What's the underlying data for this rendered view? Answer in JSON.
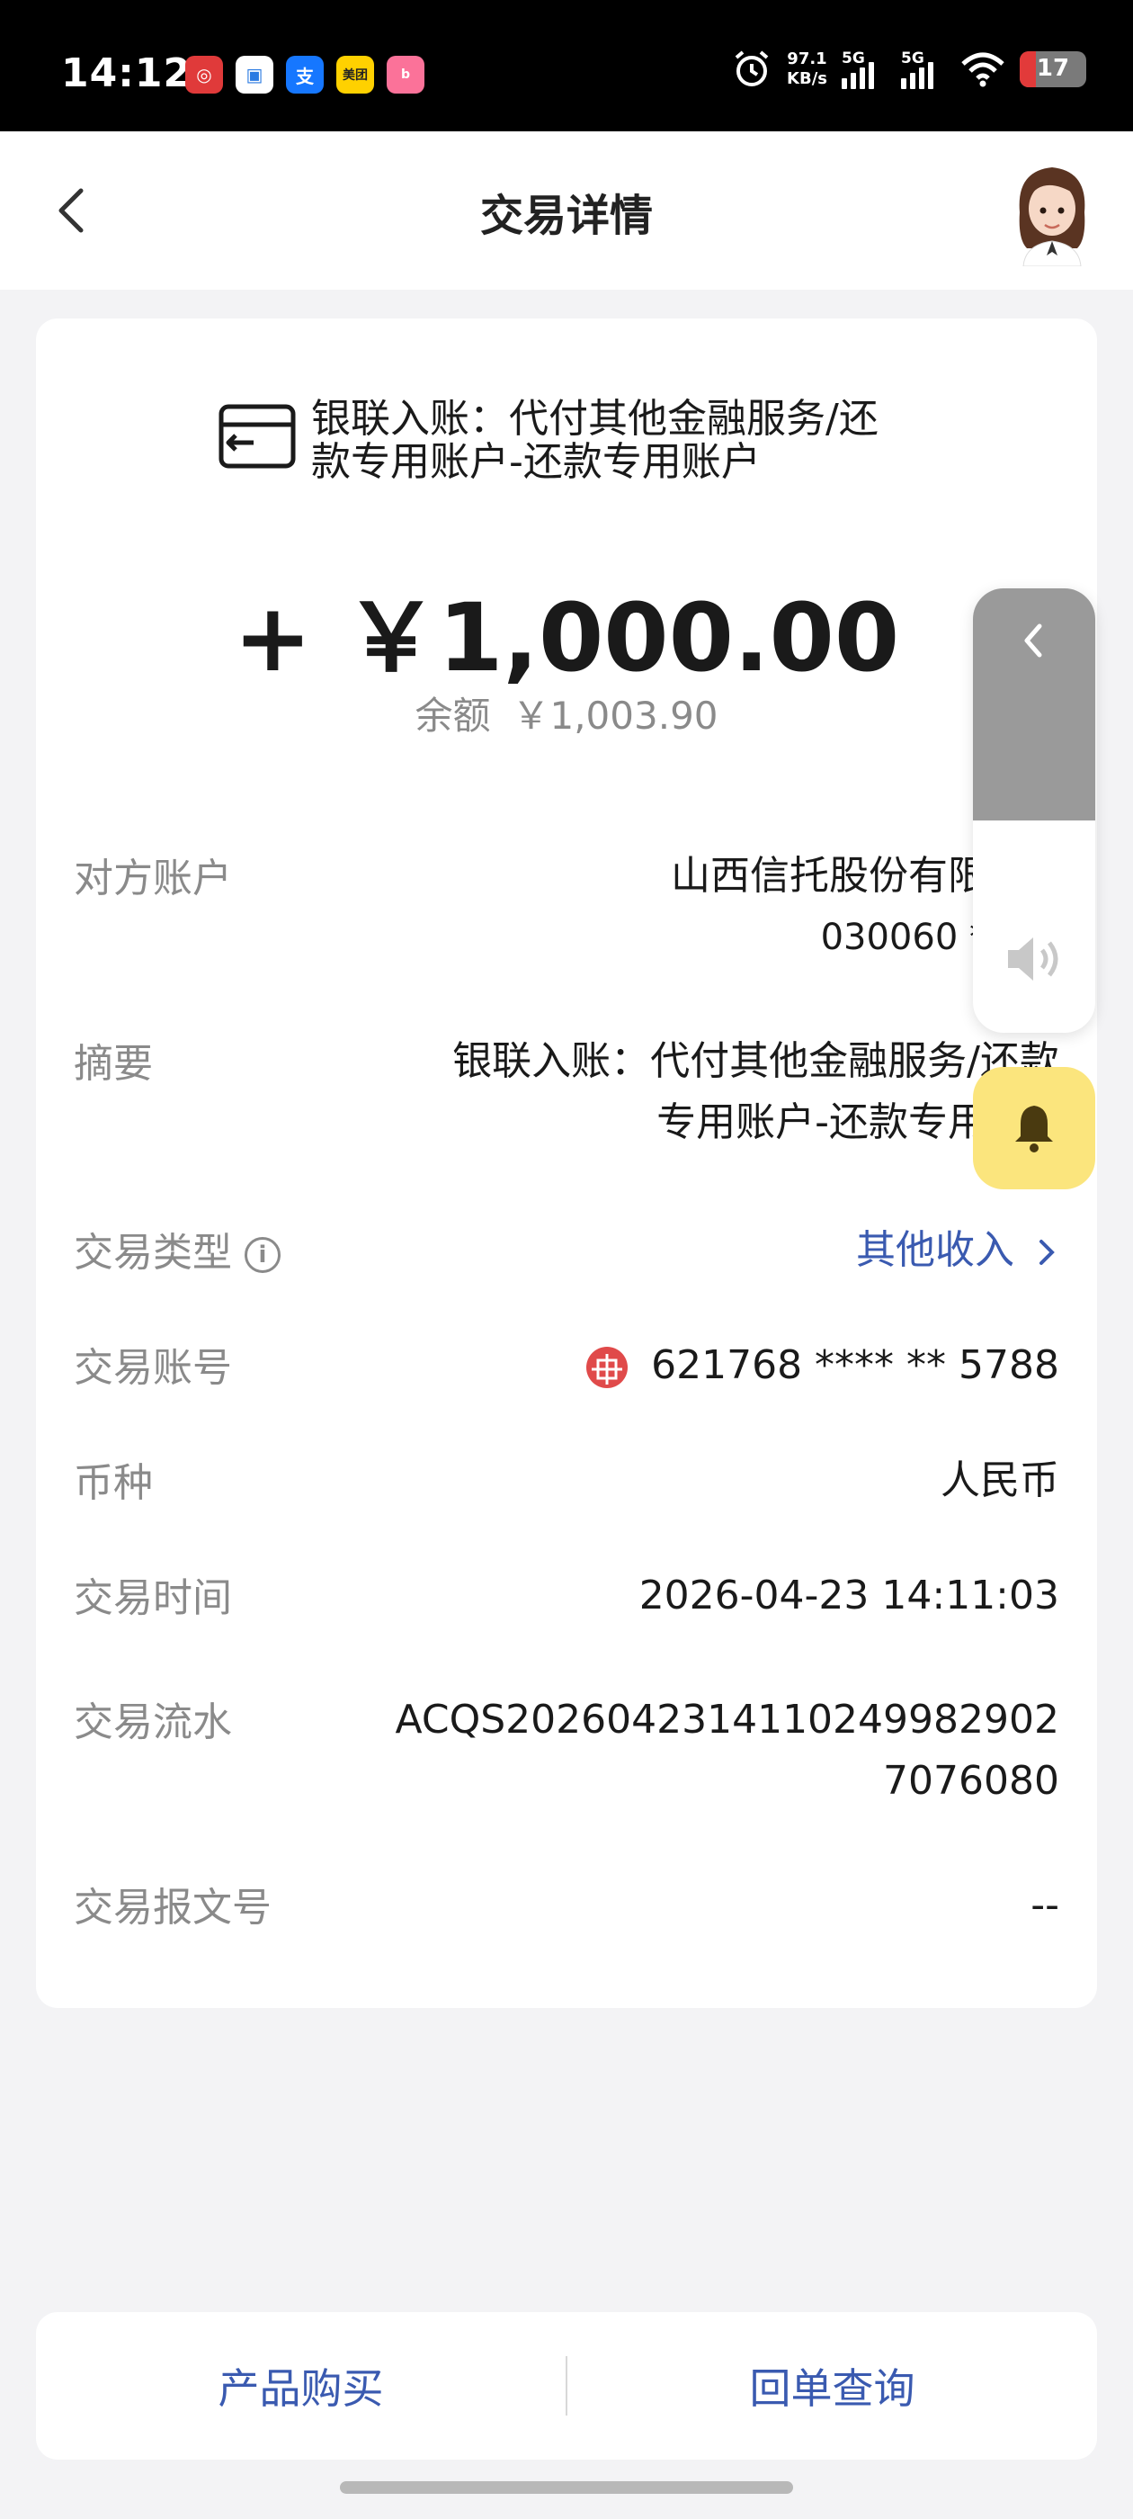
{
  "status_bar": {
    "time": "14:12",
    "net_speed_value": "97.1",
    "net_speed_unit": "KB/s",
    "signal_1": "5G",
    "signal_2": "5G",
    "battery": "17",
    "apps": [
      {
        "icon": "citic-bank-icon",
        "color": "#e03a3a",
        "glyph": "⊕"
      },
      {
        "icon": "chat-app-icon",
        "color": "#ffffff",
        "glyph": "▣"
      },
      {
        "icon": "alipay-icon",
        "color": "#1677ff",
        "glyph": "支"
      },
      {
        "icon": "meituan-icon",
        "color": "#ffd100",
        "glyph": "美团"
      },
      {
        "icon": "bilibili-icon",
        "color": "#fb7299",
        "glyph": "b"
      }
    ]
  },
  "header": {
    "title": "交易详情"
  },
  "transaction": {
    "summary": "银联入账：代付其他金融服务/还款专用账户-还款专用账户",
    "amount": "+ ￥1,000.00",
    "balance_label": "余额",
    "balance_value": "￥1,003.90"
  },
  "details": {
    "counterparty": {
      "label": "对方账户",
      "value_line1": "山西信托股份有限",
      "value_line2": "030060 *"
    },
    "memo": {
      "label": "摘要",
      "value_line1": "银联入账：代付其他金融服务/还款",
      "value_line2": "专用账户-还款专用"
    },
    "type": {
      "label": "交易类型",
      "value": "其他收入"
    },
    "account": {
      "label": "交易账号",
      "value": "621768 **** ** 5788"
    },
    "currency": {
      "label": "币种",
      "value": "人民币"
    },
    "time": {
      "label": "交易时间",
      "value": "2026-04-23 14:11:03"
    },
    "serial": {
      "label": "交易流水",
      "value_line1": "ACQS20260423141102499829​02",
      "value_line2": "7076080"
    },
    "message_no": {
      "label": "交易报文号",
      "value": "--"
    }
  },
  "bottom_actions": {
    "buy": "产品购买",
    "receipt": "回单查询"
  },
  "colors": {
    "accent": "#3a5ab0",
    "muted": "#8a8a8a",
    "bell_bg": "#fbe57d"
  }
}
